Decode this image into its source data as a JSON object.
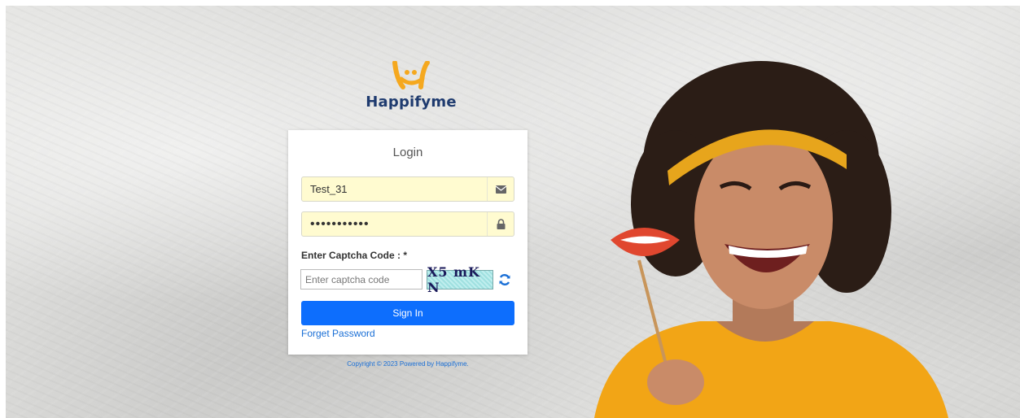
{
  "brand": {
    "name": "Happifyme",
    "logo_color": "#f5a81e",
    "text_color": "#1f3b6f"
  },
  "login": {
    "title": "Login",
    "username": {
      "value": "Test_31",
      "icon": "envelope-icon"
    },
    "password": {
      "value": "•••••••••••",
      "icon": "lock-icon"
    },
    "captcha": {
      "label": "Enter Captcha Code : *",
      "placeholder": "Enter captcha code",
      "image_text": "X5 mK N",
      "refresh_icon": "refresh-icon"
    },
    "signin_label": "Sign In",
    "forget_label": "Forget Password",
    "accent": "#0d6efd"
  },
  "footer": {
    "copyright": "Copyright © 2023  Powered by Happifyme."
  }
}
